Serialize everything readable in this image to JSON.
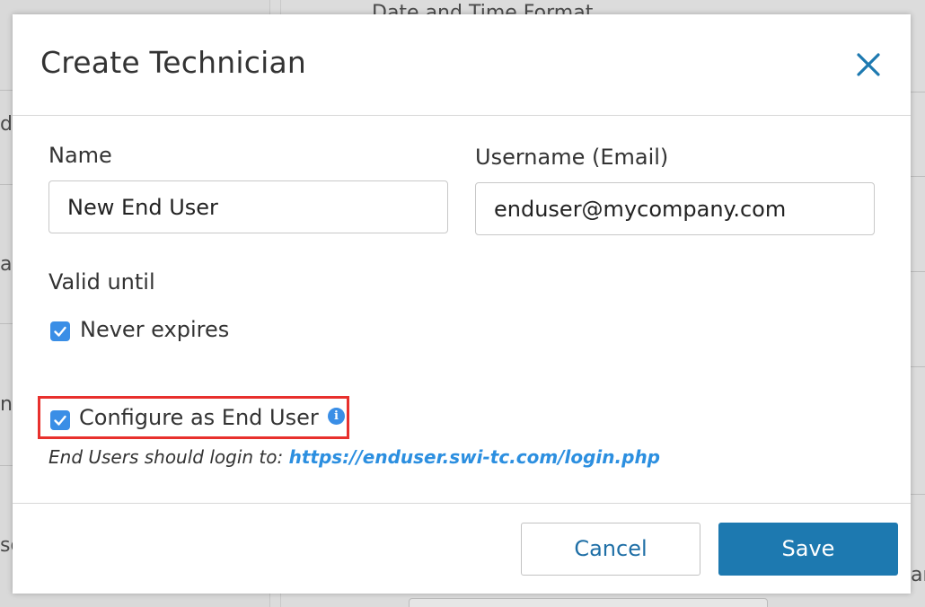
{
  "background": {
    "fragments": [
      "Date and Time Format",
      "ds",
      "ar",
      "ne",
      "so",
      "ar"
    ]
  },
  "dialog": {
    "title": "Create Technician",
    "close_icon": "close-icon",
    "name": {
      "label": "Name",
      "value": "New End User"
    },
    "username": {
      "label": "Username (Email)",
      "value": "enduser@mycompany.com"
    },
    "valid_until": {
      "label": "Valid until",
      "never_expires_label": "Never expires",
      "never_expires_checked": true
    },
    "end_user": {
      "label": "Configure as End User",
      "checked": true,
      "info_icon": "info-icon",
      "hint_prefix": "End Users should login to:",
      "hint_link": "https://enduser.swi-tc.com/login.php"
    },
    "buttons": {
      "cancel_label": "Cancel",
      "save_label": "Save"
    }
  },
  "colors": {
    "accent": "#3a8ee6",
    "primary_button": "#1d79b0",
    "highlight": "#e8302d",
    "link": "#2c8fe0"
  }
}
